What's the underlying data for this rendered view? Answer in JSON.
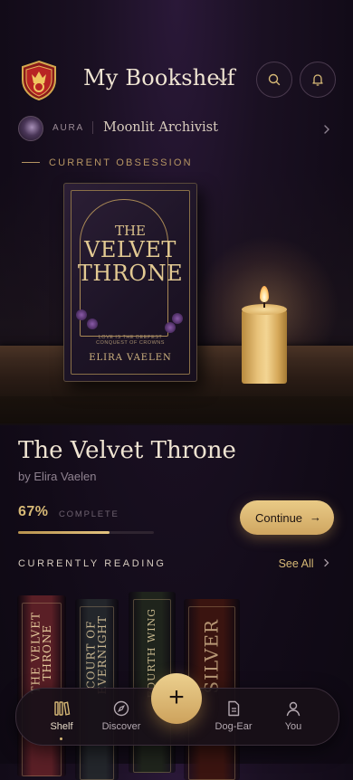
{
  "header": {
    "title": "My Bookshelf"
  },
  "aura": {
    "label": "AURA",
    "name": "Moonlit Archivist"
  },
  "section_obsession": "CURRENT OBSESSION",
  "hero_cover": {
    "line1": "THE",
    "line2": "VELVET",
    "line3": "THRONE",
    "tagline": "LOVE IS THE DEEPEST CONQUEST OF CROWNS",
    "author": "ELIRA VAELEN"
  },
  "current_book": {
    "title": "The Velvet Throne",
    "author": "by Elira Vaelen",
    "progress_percent_label": "67%",
    "progress_fraction": 0.67,
    "progress_label": "COMPLETE",
    "continue_label": "Continue",
    "continue_arrow": "→"
  },
  "reading_section": {
    "title": "CURRENTLY READING",
    "see_all": "See All"
  },
  "spines": [
    {
      "title": "THE VELVET\nTHRONE",
      "color": "#5a1f26"
    },
    {
      "title": "COURT OF\nEVERNIGHT",
      "color": "#23262b"
    },
    {
      "title": "FOURTH WING",
      "color": "#1f241c"
    },
    {
      "title": "SILVER",
      "color": "#3a1410"
    }
  ],
  "nav": {
    "items": [
      {
        "label": "Shelf",
        "icon": "books-icon",
        "active": true
      },
      {
        "label": "Discover",
        "icon": "compass-icon"
      },
      {
        "label": "Dog-Ear",
        "icon": "page-icon"
      },
      {
        "label": "You",
        "icon": "user-icon"
      }
    ],
    "fab_label": "+"
  },
  "colors": {
    "accent": "#d7b976",
    "background": "#120b18"
  }
}
